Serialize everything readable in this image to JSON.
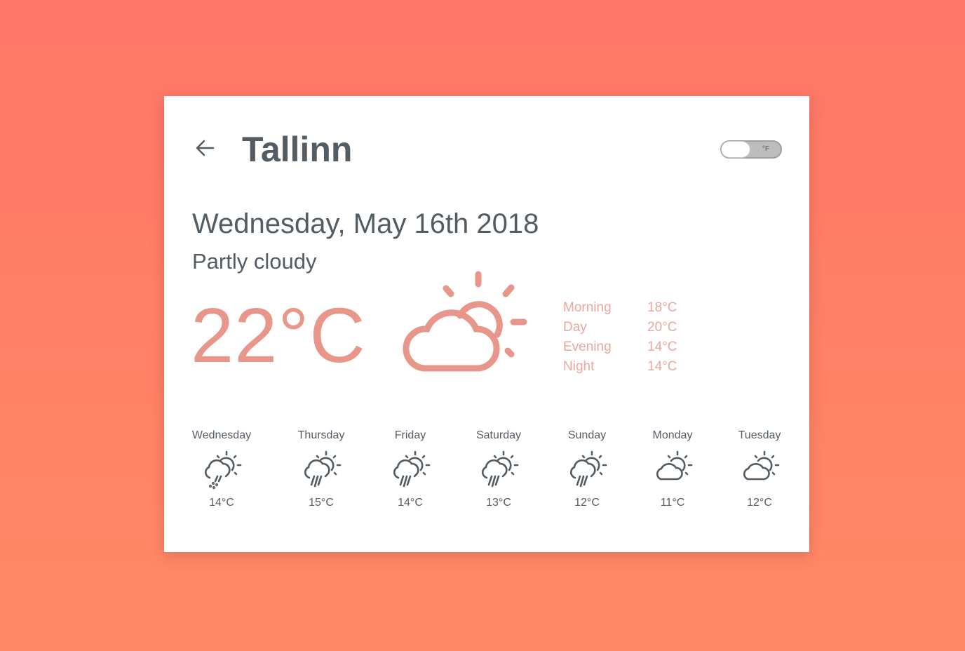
{
  "header": {
    "city": "Tallinn",
    "unit_toggle_label": "°F"
  },
  "current": {
    "date": "Wednesday, May 16th 2018",
    "condition": "Partly cloudy",
    "temperature": "22°C",
    "icon": "partly-cloudy-icon",
    "day_parts": [
      {
        "name": "Morning",
        "temp": "18°C"
      },
      {
        "name": "Day",
        "temp": "20°C"
      },
      {
        "name": "Evening",
        "temp": "14°C"
      },
      {
        "name": "Night",
        "temp": "14°C"
      }
    ]
  },
  "forecast": [
    {
      "day": "Wednesday",
      "temp": "14°C",
      "icon": "sun-cloud-sleet-icon"
    },
    {
      "day": "Thursday",
      "temp": "15°C",
      "icon": "sun-cloud-rain-icon"
    },
    {
      "day": "Friday",
      "temp": "14°C",
      "icon": "sun-cloud-rain-icon"
    },
    {
      "day": "Saturday",
      "temp": "13°C",
      "icon": "sun-cloud-rain-icon"
    },
    {
      "day": "Sunday",
      "temp": "12°C",
      "icon": "sun-cloud-rain-icon"
    },
    {
      "day": "Monday",
      "temp": "11°C",
      "icon": "partly-cloudy-icon"
    },
    {
      "day": "Tuesday",
      "temp": "12°C",
      "icon": "partly-cloudy-icon"
    }
  ],
  "colors": {
    "background_top": "#ff7668",
    "background_bottom": "#ff8a66",
    "accent": "#e8958a",
    "text": "#545c63"
  }
}
